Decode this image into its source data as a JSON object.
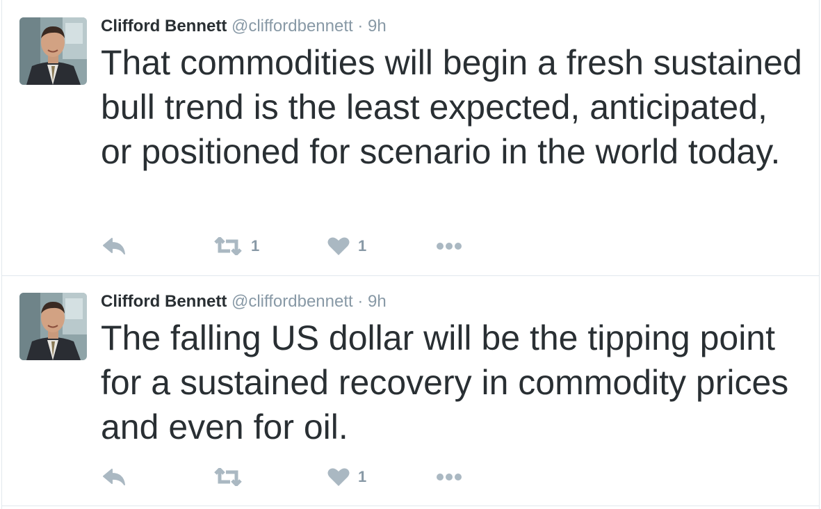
{
  "tweets": [
    {
      "author_name": "Clifford Bennett",
      "handle": "@cliffordbennett",
      "separator": "·",
      "time": "9h",
      "text": "That commodities will begin a fresh sustained bull trend is the least expected, anticipated, or positioned for scenario in the world today.",
      "retweet_count": "1",
      "like_count": "1"
    },
    {
      "author_name": "Clifford Bennett",
      "handle": "@cliffordbennett",
      "separator": "·",
      "time": "9h",
      "text": "The falling US dollar will be the tipping point for a sustained recovery in commodity prices and even for oil.",
      "retweet_count": "",
      "like_count": "1"
    }
  ],
  "icons": {
    "reply": "reply-icon",
    "retweet": "retweet-icon",
    "like": "heart-icon",
    "more": "more-icon"
  },
  "colors": {
    "text": "#292f33",
    "muted": "#8899a6",
    "icon": "#aab8c2",
    "border": "#e1e8ed"
  }
}
